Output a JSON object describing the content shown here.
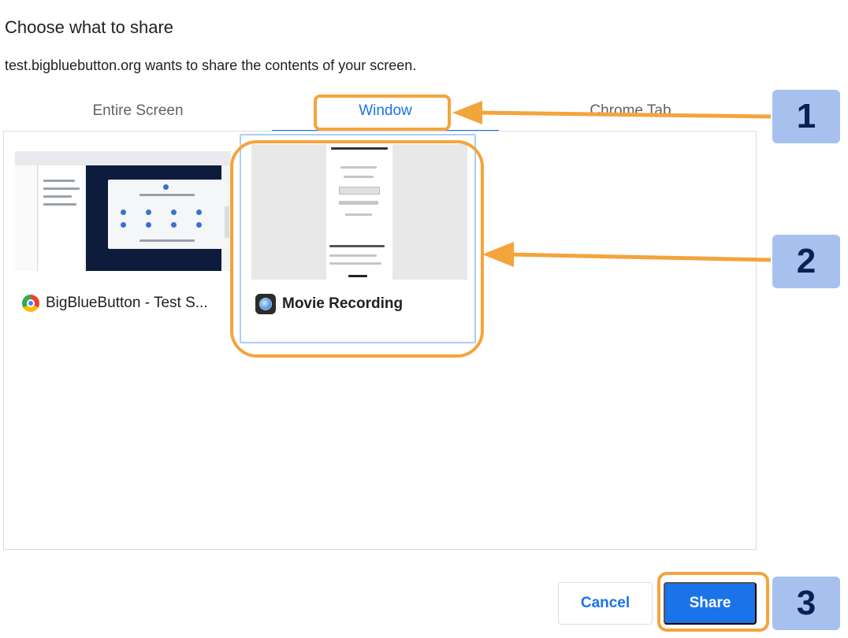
{
  "dialog": {
    "title": "Choose what to share",
    "subtitle": "test.bigbluebutton.org wants to share the contents of your screen."
  },
  "tabs": [
    {
      "label": "Entire Screen",
      "selected": false
    },
    {
      "label": "Window",
      "selected": true
    },
    {
      "label": "Chrome Tab",
      "selected": false
    }
  ],
  "sources": [
    {
      "label": "BigBlueButton - Test S...",
      "icon": "chrome-icon",
      "selected": false
    },
    {
      "label": "Movie Recording",
      "icon": "quicktime-icon",
      "selected": true
    }
  ],
  "buttons": {
    "cancel": "Cancel",
    "share": "Share"
  },
  "annotations": {
    "step1": "1",
    "step2": "2",
    "step3": "3"
  },
  "colors": {
    "accent": "#1a73e8",
    "annotation": "#f4a43c",
    "badge": "#a7c0ee"
  }
}
